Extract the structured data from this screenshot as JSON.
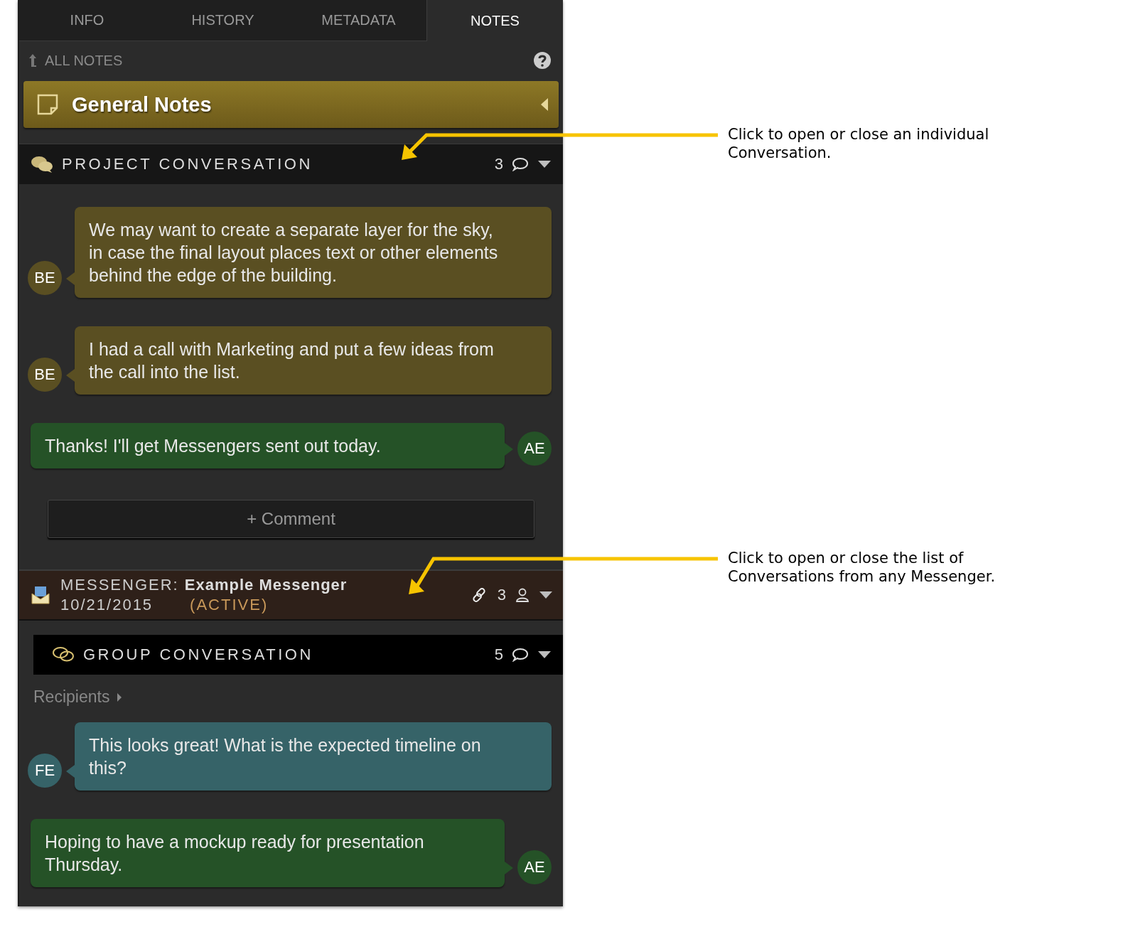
{
  "tabs": [
    {
      "label": "INFO",
      "selected": false
    },
    {
      "label": "HISTORY",
      "selected": false
    },
    {
      "label": "METADATA",
      "selected": false
    },
    {
      "label": "NOTES",
      "selected": true
    }
  ],
  "back_link": "ALL NOTES",
  "general_notes": {
    "title": "General Notes"
  },
  "project_conversation": {
    "title": "PROJECT CONVERSATION",
    "count": "3",
    "messages": [
      {
        "kind": "incoming",
        "initials": "BE",
        "color": "#5a4f22",
        "text": "We may want to create a separate layer for the sky,\nin case the final layout places text or other elements behind the edge of the building."
      },
      {
        "kind": "incoming",
        "initials": "BE",
        "color": "#5a4f22",
        "text": "I had a call with Marketing and put a few ideas from the call into the list."
      },
      {
        "kind": "outgoing",
        "initials": "AE",
        "color": "#255227",
        "text": "Thanks! I'll get Messengers sent out today."
      }
    ],
    "comment_button": "+ Comment"
  },
  "messenger": {
    "label": "MESSENGER:",
    "name": "Example Messenger",
    "date": "10/21/2015",
    "status": "(ACTIVE)",
    "count": "3"
  },
  "group_conversation": {
    "title": "GROUP CONVERSATION",
    "count": "5",
    "recipients": "Recipients",
    "messages": [
      {
        "kind": "incoming",
        "initials": "FE",
        "color": "#366368",
        "text": "This looks great! What is the expected timeline on this?"
      },
      {
        "kind": "outgoing",
        "initials": "AE",
        "color": "#255227",
        "text": "Hoping to have a mockup ready for presentation Thursday."
      }
    ]
  },
  "annotations": [
    {
      "text": "Click to open or close an individual Conversation."
    },
    {
      "text": "Click to open or close the list of Conversations from any Messenger."
    }
  ]
}
